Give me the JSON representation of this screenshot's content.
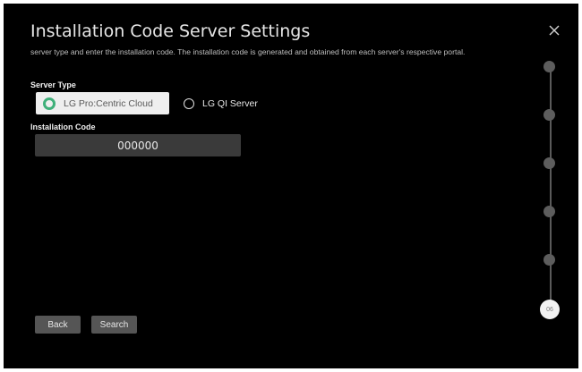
{
  "header": {
    "title": "Installation Code Server Settings",
    "subtitle": "server type and enter the installation code. The installation code is generated and obtained from each server's respective portal."
  },
  "server_type": {
    "label": "Server Type",
    "options": [
      {
        "label": "LG Pro:Centric Cloud",
        "selected": true
      },
      {
        "label": "LG QI Server",
        "selected": false
      }
    ]
  },
  "installation_code": {
    "label": "Installation Code",
    "value": "000000"
  },
  "buttons": {
    "back": "Back",
    "search": "Search"
  },
  "progress": {
    "current_step": "06",
    "total_steps": 6
  },
  "colors": {
    "background": "#000000",
    "accent_radio": "#3fb07a",
    "button": "#555555",
    "input": "#3a3a3a"
  },
  "icons": {
    "close": "close-icon"
  }
}
